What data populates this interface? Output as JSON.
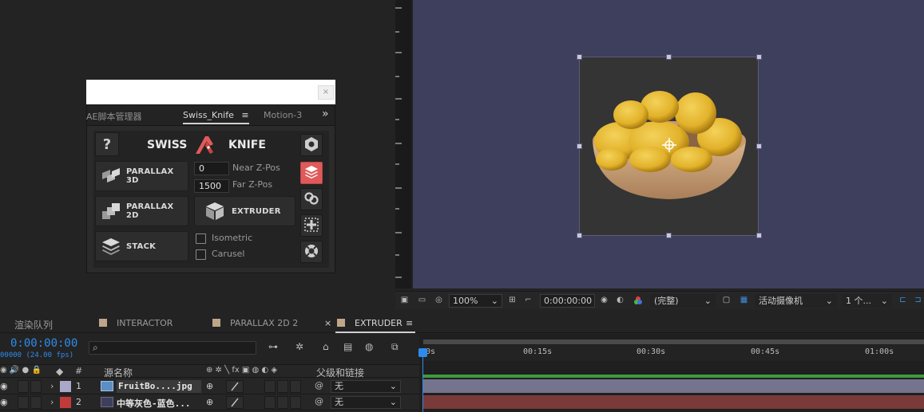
{
  "script_panel": {
    "tabs": [
      {
        "label": "AE脚本管理器"
      },
      {
        "label": "Swiss_Knife"
      },
      {
        "label": "Motion-3"
      }
    ],
    "menu_glyph": "≡",
    "overflow_glyph": "»",
    "close_glyph": "×",
    "help_label": "?",
    "title_left": "SWISS",
    "title_right": "KNIFE",
    "buttons": {
      "parallax_3d": "PARALLAX 3D",
      "parallax_2d": "PARALLAX 2D",
      "extruder": "EXTRUDER",
      "stack": "STACK"
    },
    "near_z_value": "0",
    "near_z_label": "Near Z-Pos",
    "far_z_value": "1500",
    "far_z_label": "Far Z-Pos",
    "isometric_label": "Isometric",
    "carusel_label": "Carusel",
    "accent_color": "#e05a5a"
  },
  "viewer_toolbar": {
    "zoom": "100%",
    "timecode": "0:00:00:00",
    "resolution": "(完整)",
    "camera": "活动摄像机",
    "views": "1 个..."
  },
  "timeline_tabs": [
    {
      "label": "渲染队列"
    },
    {
      "label": "INTERACTOR"
    },
    {
      "label": "PARALLAX 2D 2"
    },
    {
      "label": "EXTRUDER"
    }
  ],
  "timeline": {
    "timecode": "0:00:00:00",
    "fps": "00000 (24.00 fps)",
    "search_icon": "⌕",
    "columns": {
      "hash": "#",
      "source_name": "源名称",
      "parent": "父级和链接"
    },
    "layers": [
      {
        "index": "1",
        "name": "FruitBo....jpg",
        "parent": "无",
        "label_color": "#a9a8c9"
      },
      {
        "index": "2",
        "name": "中等灰色-蓝色...",
        "parent": "无",
        "label_color": "#c23b3b"
      }
    ],
    "ruler_ticks": [
      "0s",
      "00:15s",
      "00:30s",
      "00:45s",
      "01:00s"
    ]
  }
}
